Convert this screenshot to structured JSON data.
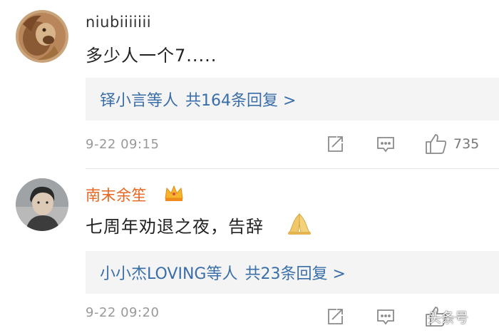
{
  "comments": [
    {
      "username": "niubiiiiiii",
      "text": "多少人一个7.....",
      "reply_summary": {
        "names": "铎小言等人",
        "count_label": "共164条回复 >"
      },
      "timestamp": "9-22 09:15",
      "likes": "735",
      "avatar_icon": "lion-avatar-icon"
    },
    {
      "username": "南末余笙",
      "badge_icon": "crown-icon",
      "text": "七周年劝退之夜，告辞",
      "text_emoji_icon": "praying-hands-icon",
      "reply_summary": {
        "names": "小小杰LOVING等人",
        "count_label": "共23条回复 >"
      },
      "timestamp": "9-22 09:20",
      "avatar_icon": "person-avatar-icon"
    }
  ],
  "watermark": {
    "text": "头条号"
  },
  "colors": {
    "link": "#3a6ea8",
    "vip_username": "#e8651f",
    "meta": "#999999"
  }
}
